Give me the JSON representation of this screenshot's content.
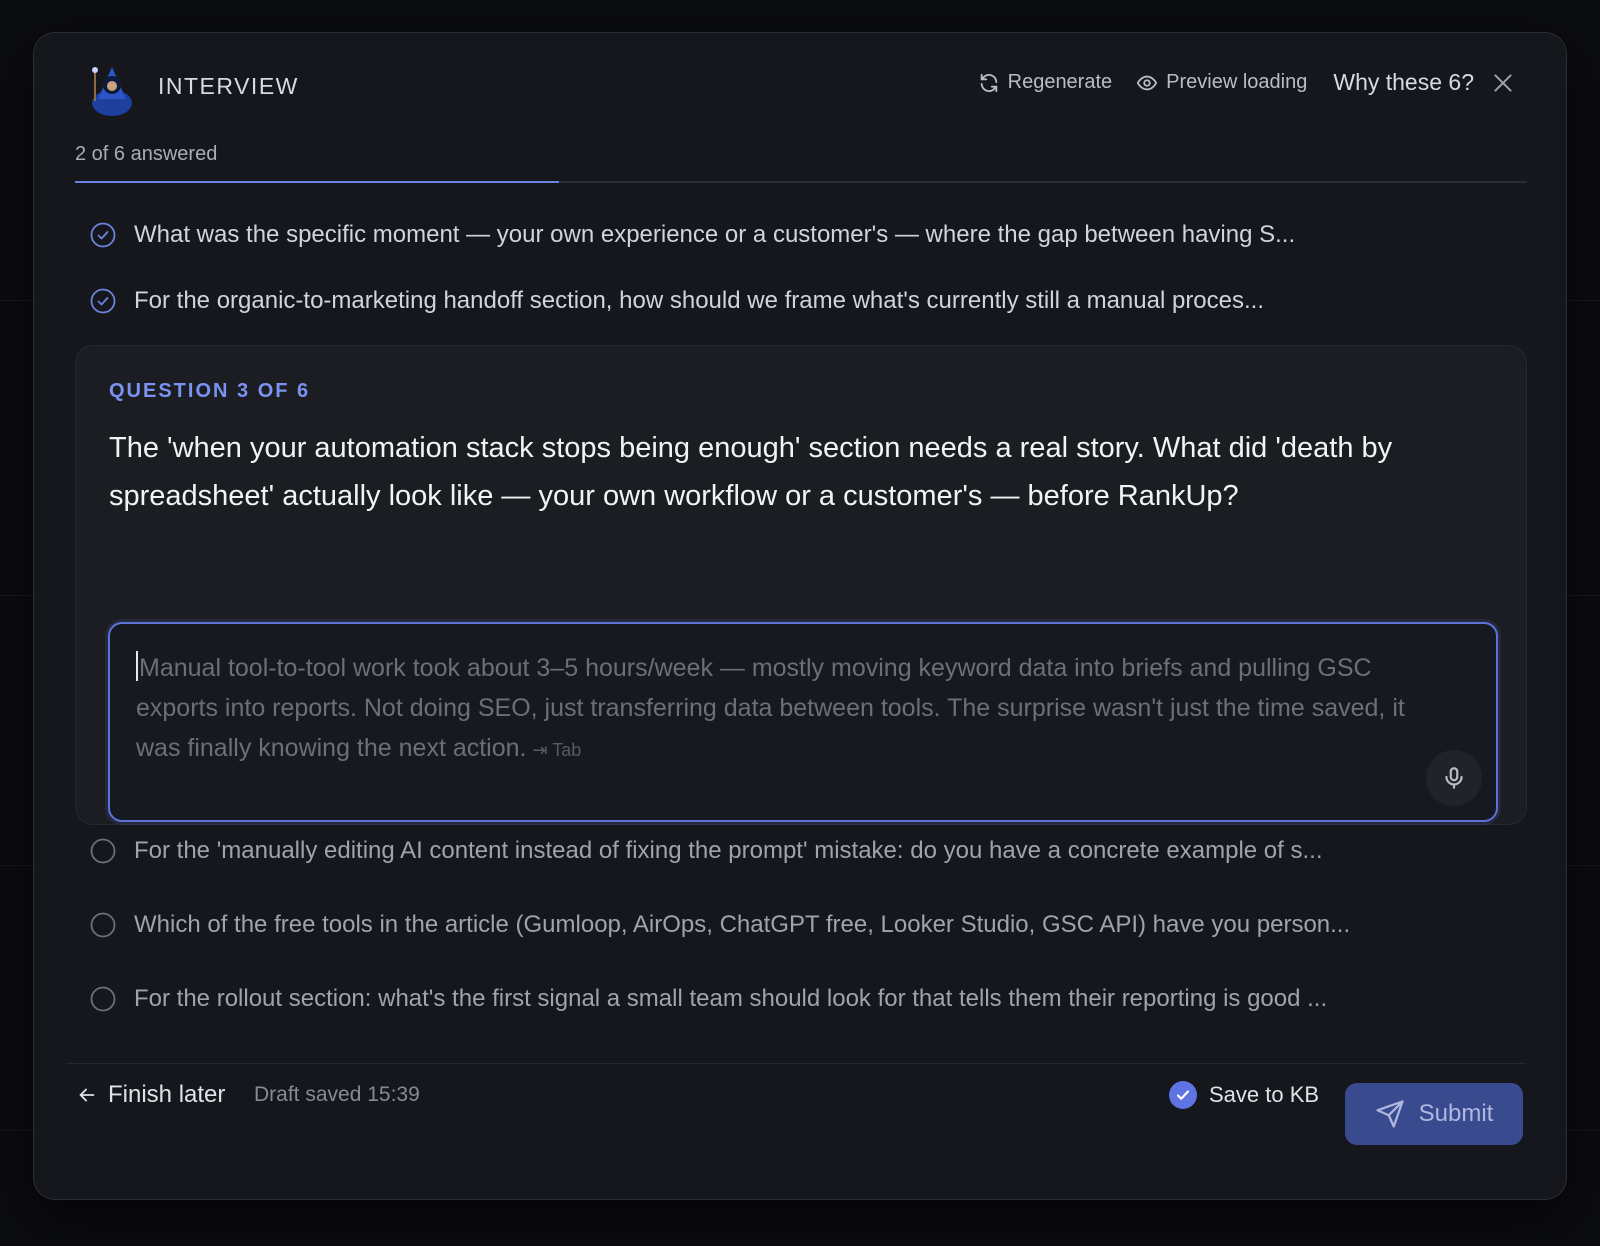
{
  "header": {
    "title": "INTERVIEW",
    "regenerate_label": "Regenerate",
    "preview_label": "Preview loading",
    "why_label": "Why these 6?"
  },
  "progress": {
    "label": "2 of 6 answered",
    "answered": 2,
    "total": 6
  },
  "answered_questions": [
    "What was the specific moment — your own experience or a customer's — where the gap between having S...",
    "For the organic-to-marketing handoff section, how should we frame what's currently still a manual proces..."
  ],
  "active": {
    "eyebrow": "QUESTION 3 OF 6",
    "question": "The 'when your automation stack stops being enough' section needs a real story. What did 'death by spreadsheet' actually look like — your own workflow or a customer's — before RankUp?",
    "placeholder": "Manual tool-to-tool work took about 3–5 hours/week — mostly moving keyword data into briefs and pulling GSC exports into reports. Not doing SEO, just transferring data between tools. The surprise wasn't just the time saved, it was finally knowing the next action.",
    "tab_hint": "⇥ Tab"
  },
  "pending_questions": [
    "For the 'manually editing AI content instead of fixing the prompt' mistake: do you have a concrete example of s...",
    "Which of the free tools in the article (Gumloop, AirOps, ChatGPT free, Looker Studio, GSC API) have you person...",
    "For the rollout section: what's the first signal a small team should look for that tells them their reporting is good ..."
  ],
  "footer": {
    "finish_label": "Finish later",
    "draft_status": "Draft saved 15:39",
    "save_kb_label": "Save to KB",
    "save_kb_checked": true,
    "submit_label": "Submit"
  },
  "colors": {
    "accent": "#5e74e4",
    "modal_bg": "#15171c",
    "card_bg": "#1b1d23"
  }
}
